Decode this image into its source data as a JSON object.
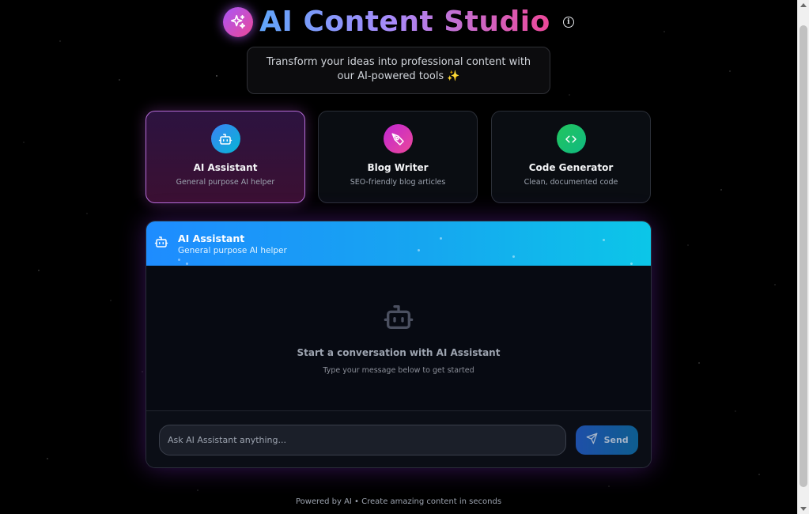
{
  "header": {
    "title": "AI Content Studio",
    "info_icon_text": "i"
  },
  "subtitle": "Transform your ideas into professional content with our AI-powered tools ✨",
  "tools": [
    {
      "title": "AI Assistant",
      "desc": "General purpose AI helper",
      "icon": "robot-icon",
      "active": true
    },
    {
      "title": "Blog Writer",
      "desc": "SEO-friendly blog articles",
      "icon": "pen-tool-icon",
      "active": false
    },
    {
      "title": "Code Generator",
      "desc": "Clean, documented code",
      "icon": "code-icon",
      "active": false
    }
  ],
  "chat": {
    "title": "AI Assistant",
    "subtitle": "General purpose AI helper",
    "empty_title": "Start a conversation with AI Assistant",
    "empty_subtitle": "Type your message below to get started",
    "input_placeholder": "Ask AI Assistant anything...",
    "input_value": "",
    "send_label": "Send"
  },
  "footer": "Powered by AI • Create amazing content in seconds",
  "colors": {
    "ai_assistant_icon": "#0ea5e9",
    "blog_writer_icon": "#d946ef",
    "code_generator_icon": "#22c55e",
    "header_gradient_start": "#1e8cff",
    "header_gradient_end": "#0cc6e8"
  }
}
